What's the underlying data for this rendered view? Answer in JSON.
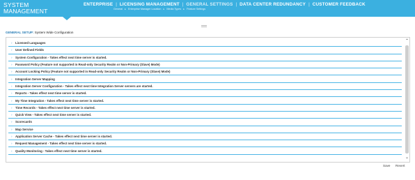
{
  "header": {
    "brand_line1": "SYSTEM",
    "brand_line2": "MANAGEMENT",
    "nav": [
      {
        "label": "ENTERPRISE",
        "active": false
      },
      {
        "label": "LICENSING MANAGEMENT",
        "active": false
      },
      {
        "label": "GENERAL SETTINGS",
        "active": true
      },
      {
        "label": "DATA CENTER REDUNDANCY",
        "active": false
      },
      {
        "label": "CUSTOMER FEEDBACK",
        "active": false
      }
    ],
    "subnav": [
      "General",
      "Enterprise Manager Location",
      "Media Types",
      "Feature Settings"
    ],
    "subnav_separator": "▸"
  },
  "page": {
    "title_label": "GENERAL SETUP:",
    "title_value": "System Wide Configuration"
  },
  "sections": [
    {
      "label": "Licensed Languages"
    },
    {
      "label": "User Defined Fields"
    },
    {
      "label": "System Configuration - Takes effect next time server is started."
    },
    {
      "label": "Password Policy (Feature not supported in Read-only Security Realm or Non-Primary (Slave) Mode)"
    },
    {
      "label": "Account Locking Policy (Feature not supported in Read-only Security Realm or Non-Primary (Slave) Mode)"
    },
    {
      "label": "Integration Server Mapping"
    },
    {
      "label": "Integration Server Configuration - Takes effect next time Integration Server servers are started."
    },
    {
      "label": "Reports - Takes effect next time server is started."
    },
    {
      "label": "My Time Integration - Takes effect next time server is started."
    },
    {
      "label": "Time Records - Takes effect next time server is started."
    },
    {
      "label": "Quick View - Takes effect next time server is started."
    },
    {
      "label": "Scorecards"
    },
    {
      "label": "Map Service"
    },
    {
      "label": "Application Server Cache - Takes effect next time server is started."
    },
    {
      "label": "Request Management - Takes effect next time server is started."
    },
    {
      "label": "Quality Monitoring - Takes effect next time server is started."
    }
  ],
  "buttons": {
    "save": "Save",
    "revert": "Revert"
  },
  "icons": {
    "expand": "chevron-right-icon",
    "scroll_up": "arrow-up-icon",
    "scroll_down": "arrow-down-icon"
  },
  "colors": {
    "header_bg": "#3bb0e0",
    "row_rule": "#4db6e6",
    "title_accent": "#2a7db5"
  }
}
